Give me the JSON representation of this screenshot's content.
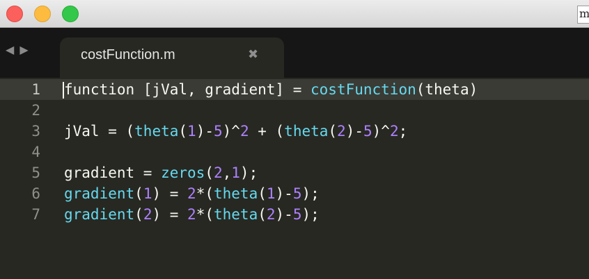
{
  "window": {
    "corner_text": "m"
  },
  "nav": {
    "back_glyph": "◀",
    "forward_glyph": "▶"
  },
  "tab": {
    "label": "costFunction.m",
    "close_glyph": "✖"
  },
  "colors": {
    "background": "#272822",
    "function": "#66d9ef",
    "number": "#ae81ff",
    "text": "#f8f8f2"
  },
  "editor": {
    "lines": [
      {
        "num": "1",
        "tokens": [
          {
            "t": "function [jVal, gradient] = ",
            "c": "plain"
          },
          {
            "t": "costFunction",
            "c": "fn"
          },
          {
            "t": "(theta)",
            "c": "plain"
          }
        ]
      },
      {
        "num": "2",
        "tokens": []
      },
      {
        "num": "3",
        "tokens": [
          {
            "t": "jVal = (",
            "c": "plain"
          },
          {
            "t": "theta",
            "c": "fn"
          },
          {
            "t": "(",
            "c": "plain"
          },
          {
            "t": "1",
            "c": "num"
          },
          {
            "t": ")-",
            "c": "plain"
          },
          {
            "t": "5",
            "c": "num"
          },
          {
            "t": ")^",
            "c": "plain"
          },
          {
            "t": "2",
            "c": "num"
          },
          {
            "t": " + (",
            "c": "plain"
          },
          {
            "t": "theta",
            "c": "fn"
          },
          {
            "t": "(",
            "c": "plain"
          },
          {
            "t": "2",
            "c": "num"
          },
          {
            "t": ")-",
            "c": "plain"
          },
          {
            "t": "5",
            "c": "num"
          },
          {
            "t": ")^",
            "c": "plain"
          },
          {
            "t": "2",
            "c": "num"
          },
          {
            "t": ";",
            "c": "plain"
          }
        ]
      },
      {
        "num": "4",
        "tokens": []
      },
      {
        "num": "5",
        "tokens": [
          {
            "t": "gradient = ",
            "c": "plain"
          },
          {
            "t": "zeros",
            "c": "fn"
          },
          {
            "t": "(",
            "c": "plain"
          },
          {
            "t": "2",
            "c": "num"
          },
          {
            "t": ",",
            "c": "plain"
          },
          {
            "t": "1",
            "c": "num"
          },
          {
            "t": ");",
            "c": "plain"
          }
        ]
      },
      {
        "num": "6",
        "tokens": [
          {
            "t": "gradient",
            "c": "fn"
          },
          {
            "t": "(",
            "c": "plain"
          },
          {
            "t": "1",
            "c": "num"
          },
          {
            "t": ") = ",
            "c": "plain"
          },
          {
            "t": "2",
            "c": "num"
          },
          {
            "t": "*(",
            "c": "plain"
          },
          {
            "t": "theta",
            "c": "fn"
          },
          {
            "t": "(",
            "c": "plain"
          },
          {
            "t": "1",
            "c": "num"
          },
          {
            "t": ")-",
            "c": "plain"
          },
          {
            "t": "5",
            "c": "num"
          },
          {
            "t": ");",
            "c": "plain"
          }
        ]
      },
      {
        "num": "7",
        "tokens": [
          {
            "t": "gradient",
            "c": "fn"
          },
          {
            "t": "(",
            "c": "plain"
          },
          {
            "t": "2",
            "c": "num"
          },
          {
            "t": ") = ",
            "c": "plain"
          },
          {
            "t": "2",
            "c": "num"
          },
          {
            "t": "*(",
            "c": "plain"
          },
          {
            "t": "theta",
            "c": "fn"
          },
          {
            "t": "(",
            "c": "plain"
          },
          {
            "t": "2",
            "c": "num"
          },
          {
            "t": ")-",
            "c": "plain"
          },
          {
            "t": "5",
            "c": "num"
          },
          {
            "t": ");",
            "c": "plain"
          }
        ]
      }
    ]
  }
}
